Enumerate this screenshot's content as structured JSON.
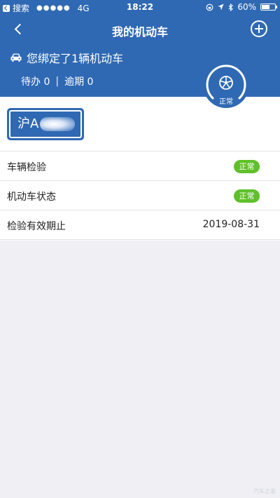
{
  "status_bar": {
    "carrier_back": "搜索",
    "signal": "●●●●●",
    "network": "4G",
    "time": "18:22",
    "battery_percent": "60%",
    "battery_level": 0.6
  },
  "header": {
    "title": "我的机动车",
    "bind_text": "您绑定了1辆机动车",
    "todo": "待办 0",
    "separator": "|",
    "overdue": "逾期 0",
    "gauge_label": "正常"
  },
  "plate": {
    "text": "沪A"
  },
  "rows": [
    {
      "label": "车辆检验",
      "badge": "正常"
    },
    {
      "label": "机动车状态",
      "badge": "正常"
    },
    {
      "label": "检验有效期止",
      "value": "2019-08-31"
    }
  ],
  "watermark": "汽车之家",
  "colors": {
    "header_blue": "#2f69b3",
    "badge_green": "#5fc02a",
    "background": "#efeff4"
  }
}
